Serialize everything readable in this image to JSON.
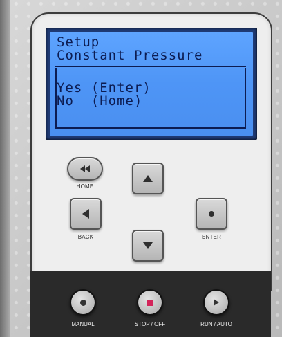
{
  "display": {
    "line1": "Setup",
    "line2": "Constant Pressure",
    "line3": "Yes (Enter)",
    "line4": "No  (Home)"
  },
  "keypad": {
    "home_label": "HOME",
    "back_label": "BACK",
    "enter_label": "ENTER"
  },
  "controls": {
    "manual_label": "MANUAL",
    "stop_label": "STOP / OFF",
    "run_label": "RUN / AUTO"
  },
  "colors": {
    "lcd_background": "#5ea4ff",
    "lcd_text": "#0c1c52",
    "stop_indicator": "#d3245a",
    "control_bar": "#2a2a2a"
  }
}
